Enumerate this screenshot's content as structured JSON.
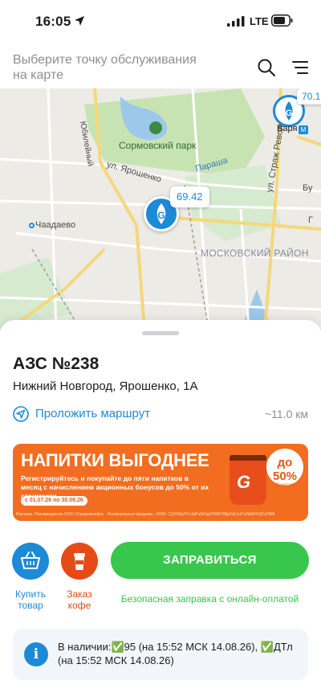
{
  "status_bar": {
    "time": "16:05",
    "network": "LTE"
  },
  "header": {
    "search_placeholder": "Выберите точку обслуживания на карте",
    "search_icon": "search-icon",
    "menu_icon": "menu-icon"
  },
  "map": {
    "park_label": "Сормовский парк",
    "district_label": "МОСКОВСКИЙ РАЙОН",
    "street_yaroshenko": "ул. Ярошенко",
    "village_label": "Чаадаево",
    "river_label": "Параша",
    "street_revolution": "ул. Страж Революции",
    "street_yubileyny": "Юбилейный",
    "label_bu": "Бу",
    "label_po": "Г",
    "station_price": "69.42",
    "station2_price": "70.1",
    "station2_label": "Варя",
    "metro_icon": "metro-icon",
    "colors": {
      "brand": "#1d8ad6",
      "park": "#c8e3b2"
    }
  },
  "station": {
    "title": "АЗС №238",
    "address": "Нижний Новгород, Ярошенко, 1А",
    "route_label": "Проложить маршрут",
    "distance": "~11.0 км"
  },
  "banner": {
    "title": "НАПИТКИ ВЫГОДНЕЕ",
    "subtitle": "Регистрируйтесь и покупайте до пяти напитков в месяц с начислением акционных бонусов до 50% от их стоимости",
    "dates": "с 01.07.26 по 30.09.26",
    "disclaimer": "Реклама. Рекламодатель ООО «Газпромнефть - Региональные продажи». ERID: CQH36pH7vJqPu2bSgZH6M74Bp2xE1oPv3dd5HrQFxFBM",
    "badge_percent": "до 50%",
    "badge_sub": "бонусов",
    "cup_brand": "G",
    "colors": {
      "bg": "#f26d1f"
    }
  },
  "actions": {
    "buy_label": "Купить товар",
    "coffee_label": "Заказ кофе",
    "refuel_label": "ЗАПРАВИТЬСЯ",
    "refuel_caption": "Безопасная заправка с онлайн-оплатой",
    "colors": {
      "buy": "#1d8ad6",
      "coffee": "#e64a16",
      "refuel": "#39c64d"
    }
  },
  "info": {
    "icon": "info-icon",
    "text": "В наличии:✅95 (на 15:52 МСК 14.08.26), ✅ДТл (на 15:52 МСК 14.08.26)"
  }
}
